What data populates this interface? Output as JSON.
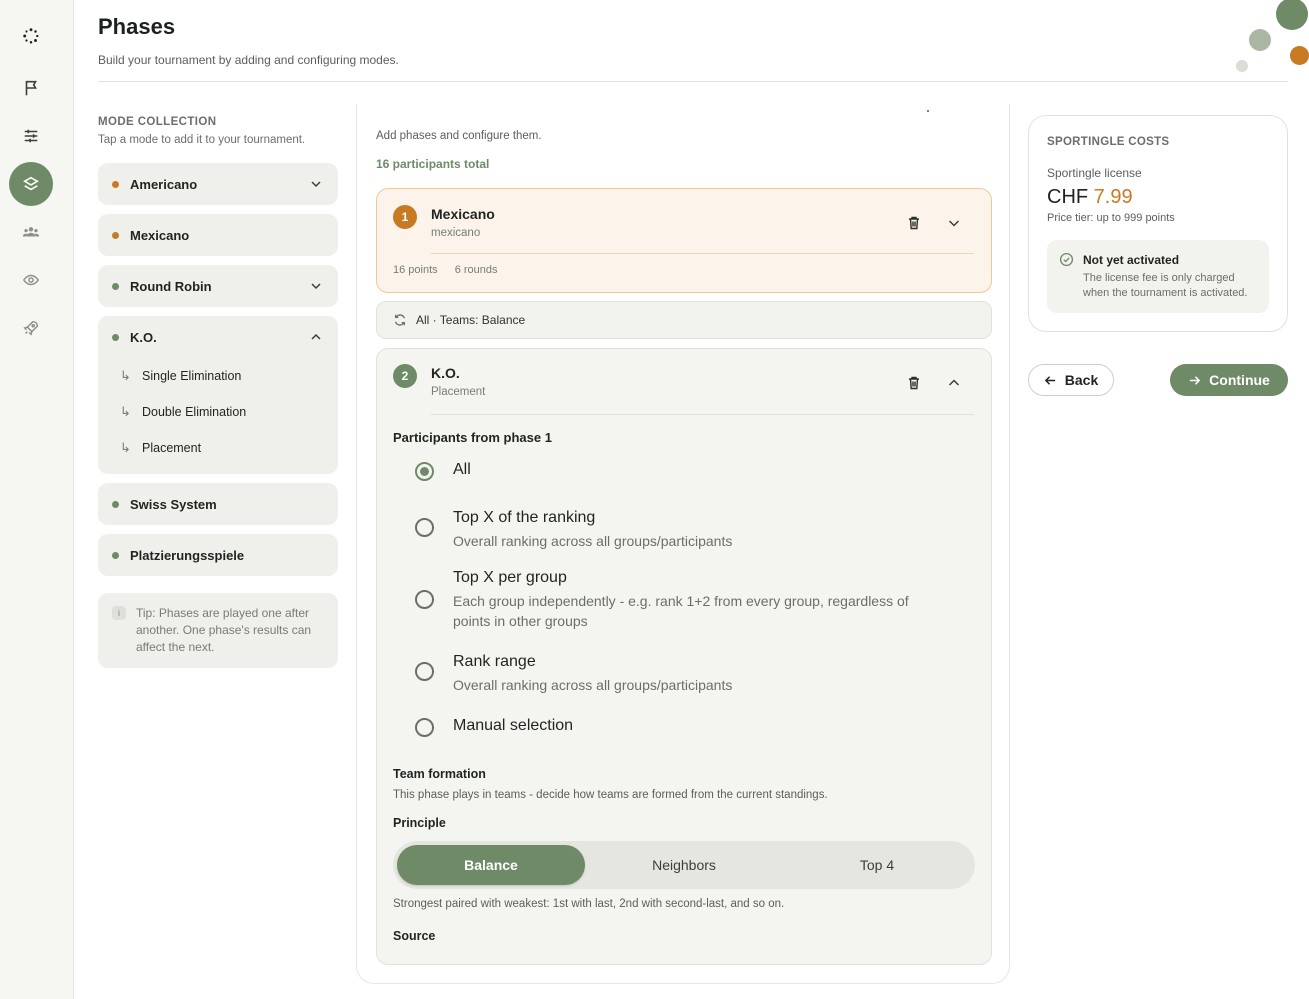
{
  "header": {
    "title": "Phases",
    "subtitle": "Build your tournament by adding and configuring modes."
  },
  "nav": {
    "items": [
      "logo-icon",
      "flag-icon",
      "sliders-icon",
      "layers-icon",
      "users-icon",
      "eye-icon",
      "rocket-icon"
    ],
    "active": "layers-icon"
  },
  "collection": {
    "heading": "MODE COLLECTION",
    "subheading": "Tap a mode to add it to your tournament.",
    "modes": [
      {
        "label": "Americano",
        "color": "#c77a22"
      },
      {
        "label": "Mexicano",
        "color": "#c77a22"
      },
      {
        "label": "Round Robin",
        "color": "#6e8a66"
      },
      {
        "label": "K.O.",
        "color": "#6e8a66"
      },
      {
        "label": "Swiss System",
        "color": "#6e8a66"
      },
      {
        "label": "Platzierungsspiele",
        "color": "#6e8a66"
      }
    ],
    "ko_sub": [
      "Single Elimination",
      "Double Elimination",
      "Placement"
    ],
    "tip": "Tip: Phases are played one after another. One phase's results can affect the next."
  },
  "center": {
    "subtitle": "Add phases and configure them.",
    "total": "16 participants total",
    "phase1": {
      "number": "1",
      "title": "Mexicano",
      "subtitle": "mexicano",
      "points": "16 points",
      "rounds": "6 rounds"
    },
    "transition": "All · Teams: Balance",
    "phase2": {
      "number": "2",
      "title": "K.O.",
      "subtitle": "Placement",
      "participants_label": "Participants from phase 1",
      "options": [
        {
          "label": "All",
          "desc": "",
          "selected": true
        },
        {
          "label": "Top X of the ranking",
          "desc": "Overall ranking across all groups/participants",
          "selected": false
        },
        {
          "label": "Top X per group",
          "desc": "Each group independently - e.g. rank 1+2 from every group, regardless of points in other groups",
          "selected": false
        },
        {
          "label": "Rank range",
          "desc": "Overall ranking across all groups/participants",
          "selected": false
        },
        {
          "label": "Manual selection",
          "desc": "",
          "selected": false
        }
      ],
      "team_formation_label": "Team formation",
      "team_formation_text": "This phase plays in teams - decide how teams are formed from the current standings.",
      "principle_label": "Principle",
      "principle_options": [
        "Balance",
        "Neighbors",
        "Top 4"
      ],
      "principle_selected": "Balance",
      "principle_desc": "Strongest paired with weakest: 1st with last, 2nd with second-last, and so on.",
      "source_label": "Source"
    }
  },
  "costs": {
    "heading": "SPORTINGLE COSTS",
    "license_label": "Sportingle license",
    "currency": "CHF",
    "price": "7.99",
    "tier": "Price tier: up to 999 points",
    "status_title": "Not yet activated",
    "status_text": "The license fee is only charged when the tournament is activated."
  },
  "actions": {
    "back": "Back",
    "continue": "Continue"
  },
  "colors": {
    "accent": "#6e8a66",
    "orange": "#c77a22"
  }
}
